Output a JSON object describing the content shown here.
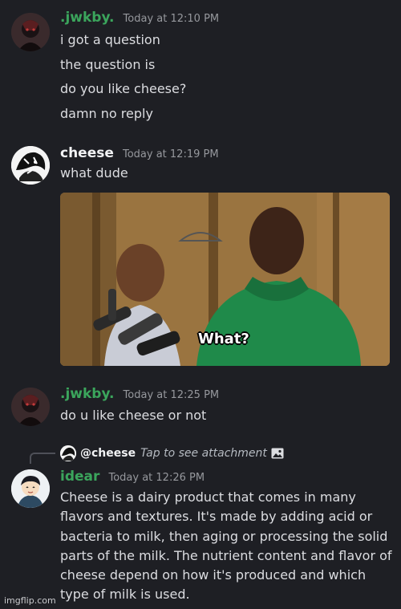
{
  "messages": [
    {
      "username": ".jwkby.",
      "timestamp": "Today at 12:10 PM",
      "lines": [
        "i got a question",
        "the question is",
        "do you like cheese?",
        "damn no reply"
      ]
    },
    {
      "username": "cheese",
      "timestamp": "Today at 12:19 PM",
      "lines": [
        "what dude"
      ],
      "attachment": {
        "caption": "What?"
      }
    },
    {
      "username": ".jwkby.",
      "timestamp": "Today at 12:25 PM",
      "lines": [
        "do u like cheese or not"
      ]
    },
    {
      "username": "idear",
      "timestamp": "Today at 12:26 PM",
      "reply": {
        "user": "@cheese",
        "text": "Tap to see attachment",
        "icon": "image-icon"
      },
      "lines": [
        "Cheese is a dairy product that comes in many flavors and textures. It's made by adding acid or bacteria to milk, then aging or processing the solid parts of the milk. The nutrient content and flavor of cheese depend on how it's produced and which type of milk is used."
      ]
    }
  ],
  "watermark": "imgflip.com",
  "colors": {
    "background": "#1e1f24",
    "username_green": "#3ba55c",
    "text": "#dcdde1",
    "timestamp": "#96989d"
  }
}
